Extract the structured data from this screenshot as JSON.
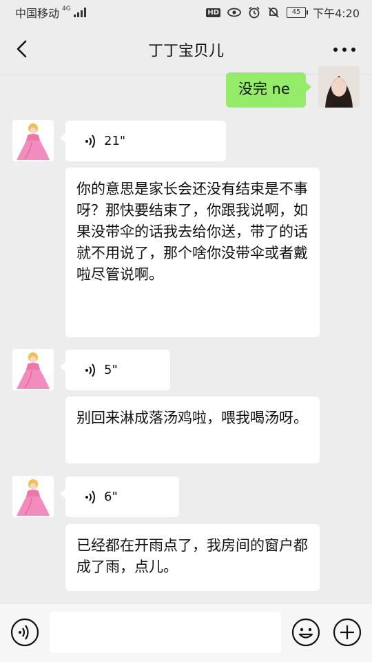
{
  "status_bar": {
    "carrier": "中国移动",
    "network": "4G",
    "hd": "HD",
    "battery": "45",
    "time": "下午4:20"
  },
  "header": {
    "title": "丁丁宝贝儿"
  },
  "messages": [
    {
      "type": "text",
      "sender": "me",
      "text": "没完 ne"
    },
    {
      "type": "voice",
      "sender": "contact",
      "duration": "21\""
    },
    {
      "type": "text",
      "sender": "contact",
      "text": "你的意思是家长会还没有结束是不事呀？那快要结束了，你跟我说啊，如果没带伞的话我去给你送，带了的话就不用说了，那个啥你没带伞或者戴啦尽管说啊。"
    },
    {
      "type": "voice",
      "sender": "contact",
      "duration": "5\""
    },
    {
      "type": "text",
      "sender": "contact",
      "text": "别回来淋成落汤鸡啦，喂我喝汤呀。"
    },
    {
      "type": "voice",
      "sender": "contact",
      "duration": "6\""
    },
    {
      "type": "text",
      "sender": "contact",
      "text": "已经都在开雨点了，我房间的窗户都成了雨，点儿。"
    }
  ],
  "colors": {
    "background": "#ededed",
    "my_bubble": "#95ec69",
    "their_bubble": "#ffffff"
  },
  "icons": {
    "back": "chevron-left-icon",
    "more": "more-dots-icon",
    "voice_toggle": "voice-icon",
    "emoji": "emoji-icon",
    "plus": "plus-icon"
  }
}
